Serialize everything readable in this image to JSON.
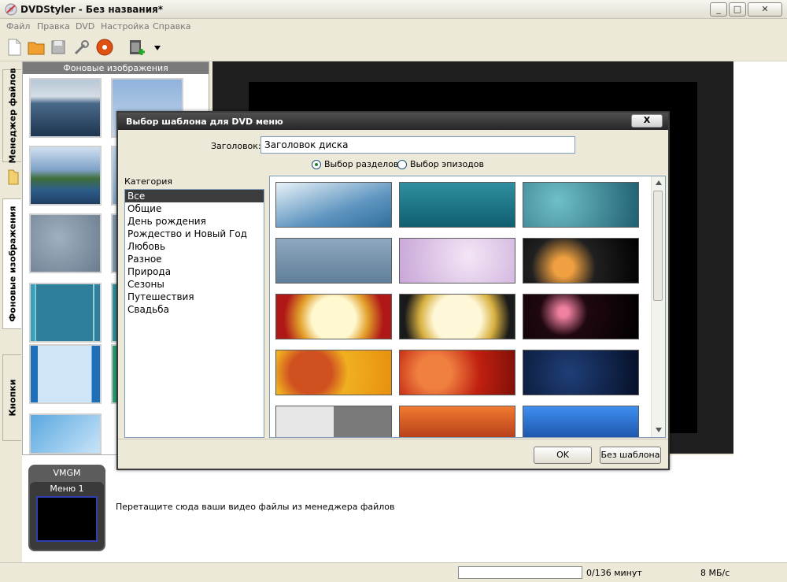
{
  "window": {
    "title": "DVDStyler - Без названия*",
    "btn_min": "_",
    "btn_max": "□",
    "btn_close": "✕"
  },
  "menu": [
    "Файл",
    "Правка",
    "DVD",
    "Настройка",
    "Справка"
  ],
  "sidetabs": {
    "file_manager": "Менеджер файлов",
    "backgrounds": "Фоновые изображения",
    "buttons": "Кнопки"
  },
  "panel": {
    "title": "Фоновые изображения"
  },
  "bottom": {
    "vmgm": "VMGM",
    "menu1": "Меню 1",
    "hint": "Перетащите сюда ваши видео файлы из менеджера файлов"
  },
  "status": {
    "duration": "0/136 минут",
    "bitrate": "8 МБ/с",
    "progress": 0
  },
  "dialog": {
    "title": "Выбор шаблона для DVD меню",
    "close": "X",
    "title_label": "Заголовок:",
    "title_value": "Заголовок диска",
    "radio_chapters": "Выбор разделов",
    "radio_episodes": "Выбор эпизодов",
    "category_label": "Категория",
    "categories": [
      "Все",
      "Общие",
      "День рождения",
      "Рождество и Новый Год",
      "Любовь",
      "Разное",
      "Природа",
      "Сезоны",
      "Путешествия",
      "Свадьба"
    ],
    "selected_category": "Все",
    "ok": "OK",
    "no_template": "Без шаблона"
  }
}
